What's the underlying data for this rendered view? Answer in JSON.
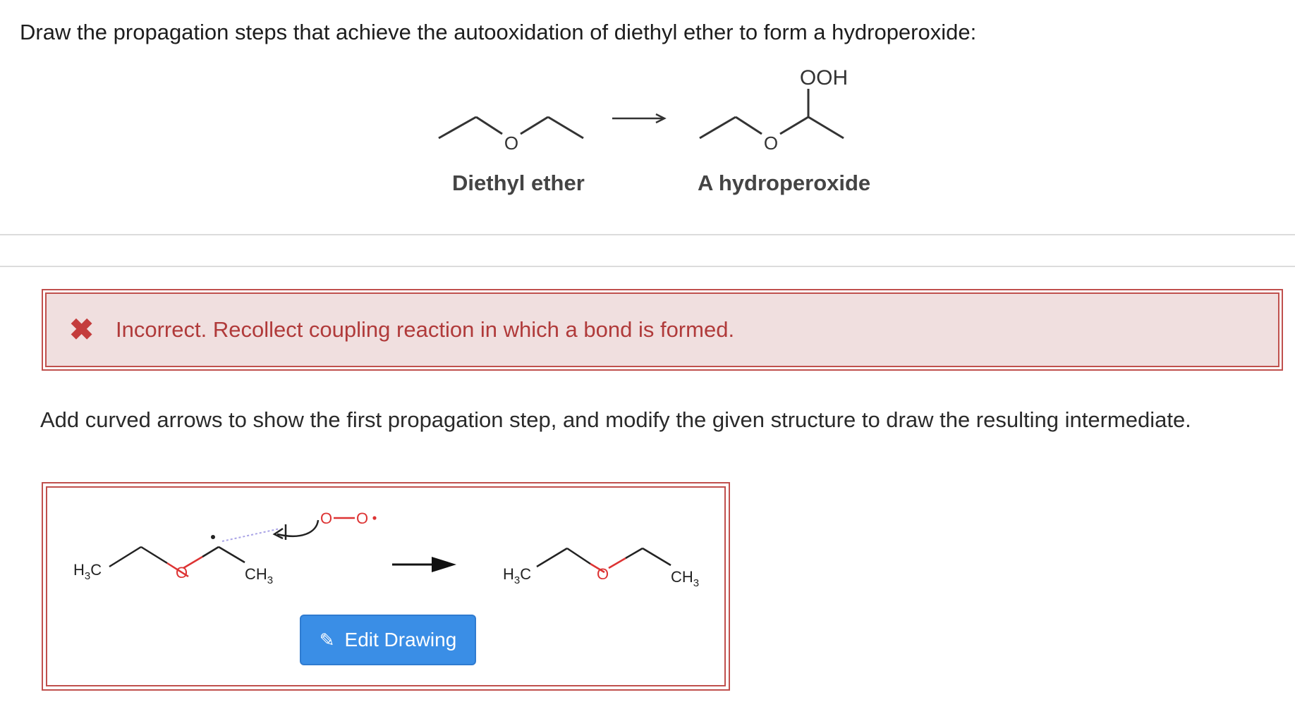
{
  "question": {
    "text": "Draw the propagation steps that achieve the autooxidation of diethyl ether to form a hydroperoxide:"
  },
  "scheme": {
    "reactant_label": "Diethyl ether",
    "product_label": "A hydroperoxide",
    "reactant_oxygen": "O",
    "product_oxygen": "O",
    "product_substituent": "OOH"
  },
  "feedback": {
    "icon": "close-x-icon",
    "text": "Incorrect. Recollect coupling reaction in which a bond is formed.",
    "color": "#b03a3a",
    "background": "#f0dfdf"
  },
  "instruction": {
    "text": "Add curved arrows to show the first propagation step, and modify the given structure to draw the resulting intermediate."
  },
  "drawing": {
    "left_molecule": {
      "h3c": "H",
      "h3c_sub": "3",
      "h3c_c": "C",
      "oxygen": "O",
      "ch3_c": "CH",
      "ch3_sub": "3"
    },
    "radical": {
      "o1": "O",
      "o2": "O"
    },
    "right_molecule": {
      "h3c": "H",
      "h3c_sub": "3",
      "h3c_c": "C",
      "oxygen": "O",
      "ch3_c": "CH",
      "ch3_sub": "3"
    },
    "edit_button_label": "Edit Drawing",
    "edit_button_icon": "pencil-icon",
    "accent_color": "#3a8ee6"
  }
}
